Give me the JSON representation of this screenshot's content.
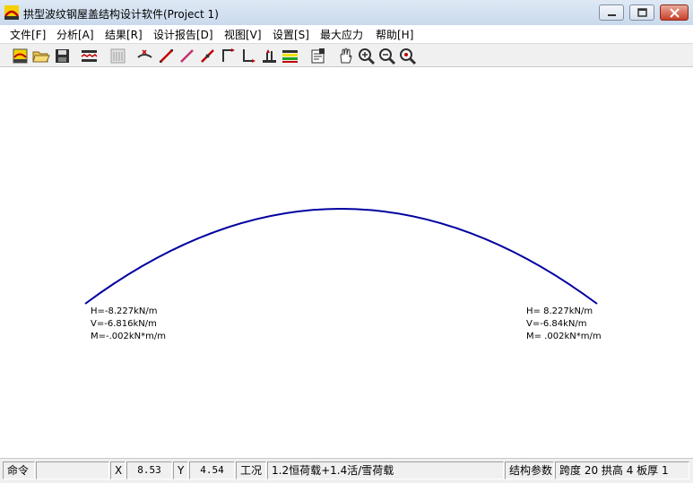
{
  "window": {
    "title": "拱型波纹钢屋盖结构设计软件(Project 1)"
  },
  "menu": [
    {
      "label": "文件[F]"
    },
    {
      "label": "分析[A]"
    },
    {
      "label": "结果[R]"
    },
    {
      "label": "设计报告[D]"
    },
    {
      "label": "视图[V]"
    },
    {
      "label": "设置[S]"
    },
    {
      "label": "最大应力"
    },
    {
      "label": "帮助[H]"
    }
  ],
  "toolbar_icons": [
    "new-project-icon",
    "open-folder-icon",
    "save-disk-icon",
    "section-icon",
    "calculator-icon",
    "load-icon",
    "member-diagonal-icon-1",
    "member-diagonal-icon-2",
    "member-diagonal-icon-3",
    "support-left-icon",
    "support-right-icon",
    "structure-icon",
    "color-legend-icon",
    "properties-icon",
    "pan-hand-icon",
    "zoom-in-icon",
    "zoom-out-icon",
    "zoom-fit-icon"
  ],
  "reactions": {
    "left": {
      "H": "H=-8.227kN/m",
      "V": "V=-6.816kN/m",
      "M": "M=-.002kN*m/m"
    },
    "right": {
      "H": "H= 8.227kN/m",
      "V": "V=-6.84kN/m",
      "M": "M= .002kN*m/m"
    }
  },
  "arch": {
    "color": "#0000a0"
  },
  "status": {
    "command_label": "命令",
    "command_value": "",
    "x_label": "X",
    "x_value": "8.53",
    "y_label": "Y",
    "y_value": "4.54",
    "case_label": "工况",
    "case_value": "1.2恒荷载+1.4活/雪荷载",
    "struct_label": "结构参数",
    "struct_value": "跨度 20 拱高 4 板厚 1"
  }
}
